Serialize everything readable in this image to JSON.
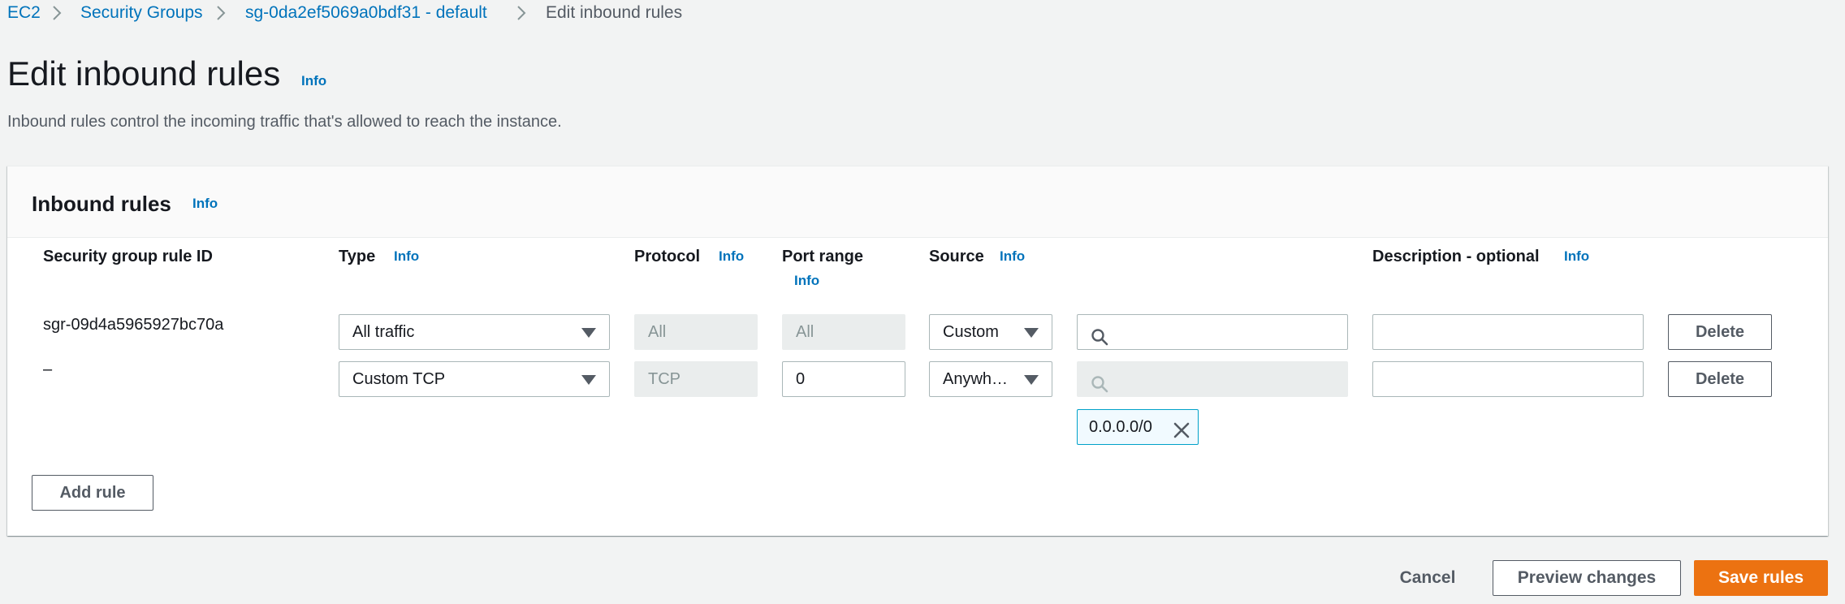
{
  "breadcrumb": {
    "items": [
      "EC2",
      "Security Groups",
      "sg-0da2ef5069a0bdf31 - default"
    ],
    "current": "Edit inbound rules"
  },
  "header": {
    "title": "Edit inbound rules",
    "info": "Info",
    "description": "Inbound rules control the incoming traffic that's allowed to reach the instance."
  },
  "panel": {
    "title": "Inbound rules",
    "info": "Info",
    "columns": {
      "rule_id": "Security group rule ID",
      "type": "Type",
      "protocol": "Protocol",
      "port_range": "Port range",
      "source": "Source",
      "description": "Description - optional",
      "info": "Info"
    },
    "rows": [
      {
        "rule_id": "sgr-09d4a5965927bc70a",
        "type": "All traffic",
        "protocol": "All",
        "port_range": "All",
        "source": "Custom",
        "search_value": "",
        "description_value": "",
        "delete": "Delete"
      },
      {
        "rule_id": "–",
        "type": "Custom TCP",
        "protocol": "TCP",
        "port_range": "0",
        "source": "Anywh…",
        "search_value": "",
        "token": "0.0.0.0/0",
        "description_value": "",
        "delete": "Delete"
      }
    ],
    "add_rule": "Add rule"
  },
  "footer": {
    "cancel": "Cancel",
    "preview": "Preview changes",
    "save": "Save rules"
  },
  "colors": {
    "link": "#0073bb",
    "primary": "#ec7211",
    "background": "#f2f3f3"
  },
  "icons": [
    "chevron-right-icon",
    "caret-down-icon",
    "search-icon",
    "close-icon"
  ]
}
